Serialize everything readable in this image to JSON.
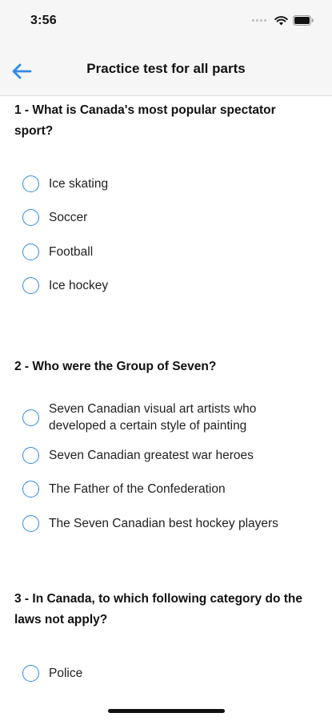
{
  "status": {
    "time": "3:56"
  },
  "nav": {
    "title": "Practice test for all parts",
    "back_icon": "arrow-left-icon"
  },
  "colors": {
    "accent": "#2f8ae6",
    "bar_bg": "#f6f6f7"
  },
  "questions": [
    {
      "title": "1 - What is Canada's most popular spectator sport?",
      "options": [
        "Ice skating",
        "Soccer",
        "Football",
        "Ice hockey"
      ]
    },
    {
      "title": "2 - Who were the Group of Seven?",
      "options": [
        "Seven Canadian visual art artists who developed a certain style of painting",
        "Seven Canadian greatest war heroes",
        "The Father of the Confederation",
        "The Seven Canadian best hockey players"
      ]
    },
    {
      "title": "3 - In Canada, to which following category do the laws not apply?",
      "options": [
        "Police"
      ]
    }
  ]
}
